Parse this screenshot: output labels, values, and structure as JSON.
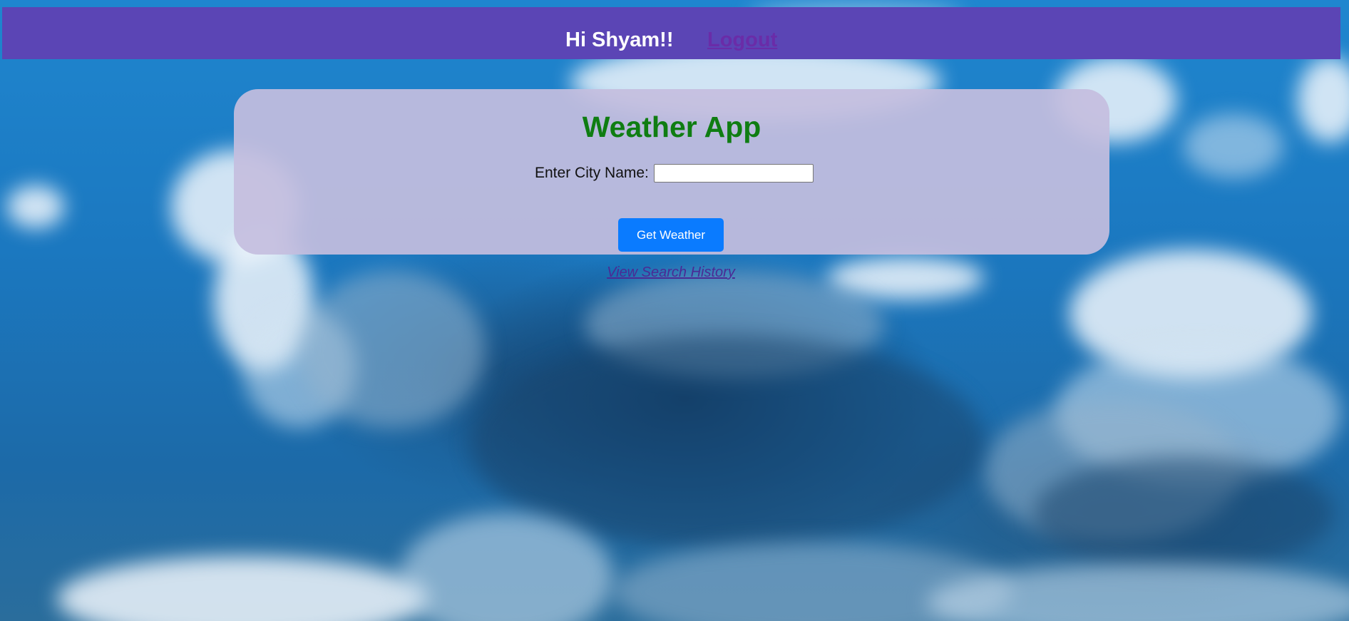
{
  "header": {
    "greeting": "Hi Shyam!!",
    "logout_label": "Logout"
  },
  "card": {
    "title": "Weather App",
    "city_label": "Enter City Name:",
    "city_value": "",
    "city_placeholder": "",
    "button_label": "Get Weather"
  },
  "history_link_label": "View Search History",
  "colors": {
    "header_bg": "#5b45b5",
    "title_green": "#0f7d12",
    "button_blue": "#0a7bff",
    "link_purple": "#6a2ca8"
  },
  "background": {
    "icon": "sky-clouds-image"
  }
}
